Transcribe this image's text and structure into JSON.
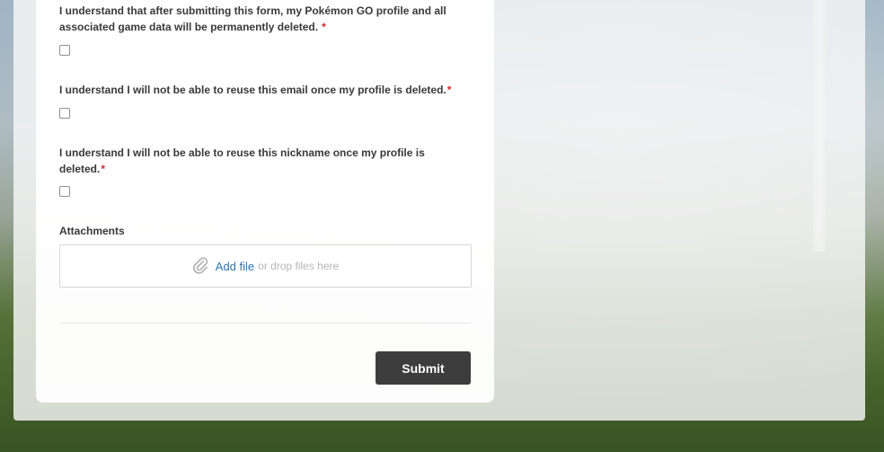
{
  "form": {
    "questions": [
      {
        "text": "I understand that after submitting this form, my Pokémon GO profile and all associated game data will be permanently deleted.",
        "required_mark": "*",
        "checked": false
      },
      {
        "text": "I understand I will not be able to reuse this email once my profile is deleted.",
        "required_mark": "*",
        "checked": false
      },
      {
        "text": "I understand I will not be able to reuse this nickname once my profile is deleted.",
        "required_mark": "*",
        "checked": false
      }
    ],
    "attachments": {
      "label": "Attachments",
      "add_file_link": "Add file",
      "drop_text": "or drop files here",
      "icon": "paperclip-icon"
    },
    "submit_label": "Submit"
  },
  "colors": {
    "required": "#d8242b",
    "link": "#2f73b0",
    "submit_bg": "#3d3d3d"
  }
}
